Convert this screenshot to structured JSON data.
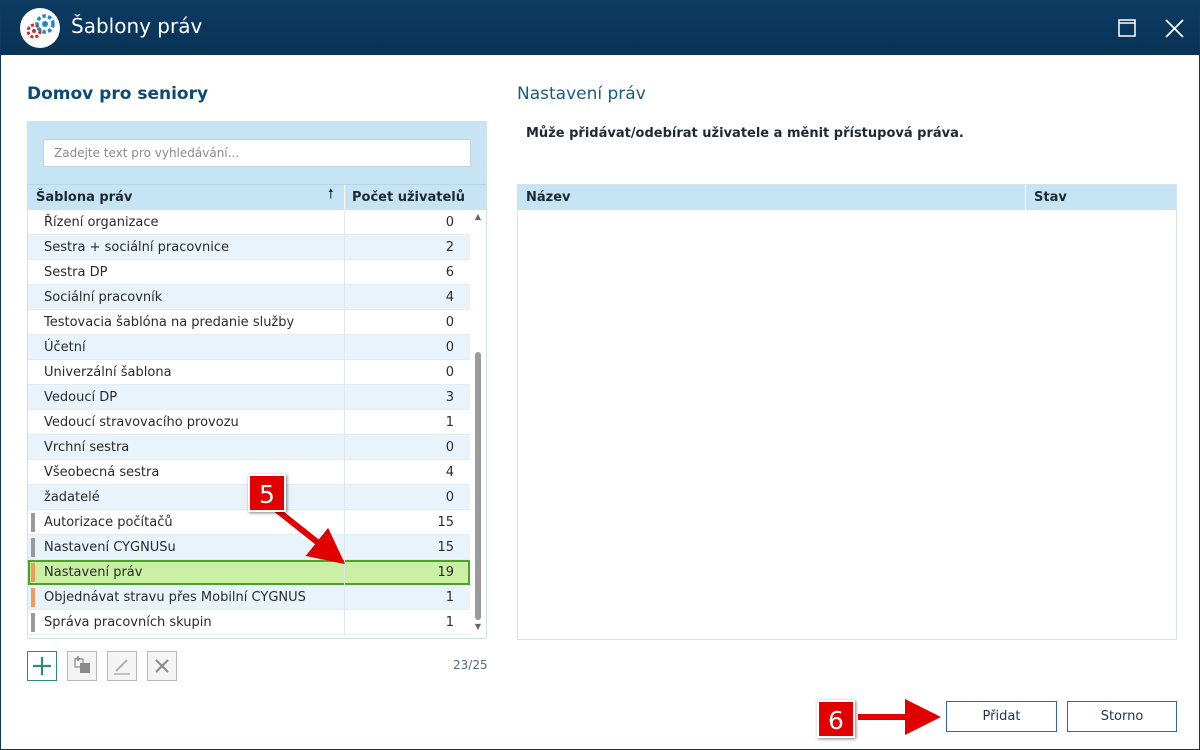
{
  "window": {
    "title": "Šablony práv"
  },
  "left": {
    "heading": "Domov pro seniory",
    "search_placeholder": "Zadejte text pro vyhledávání...",
    "columns": {
      "name": "Šablona práv",
      "count": "Počet uživatelů"
    },
    "rows": [
      {
        "name": "Řízení organizace",
        "count": "0",
        "marker": ""
      },
      {
        "name": "Sestra + sociální pracovnice",
        "count": "2",
        "marker": ""
      },
      {
        "name": "Sestra DP",
        "count": "6",
        "marker": ""
      },
      {
        "name": "Sociální pracovník",
        "count": "4",
        "marker": ""
      },
      {
        "name": "Testovacia šablóna na predanie služby",
        "count": "0",
        "marker": ""
      },
      {
        "name": "Účetní",
        "count": "0",
        "marker": ""
      },
      {
        "name": "Univerzální šablona",
        "count": "0",
        "marker": ""
      },
      {
        "name": "Vedoucí DP",
        "count": "3",
        "marker": ""
      },
      {
        "name": "Vedoucí stravovacího provozu",
        "count": "1",
        "marker": ""
      },
      {
        "name": "Vrchní sestra",
        "count": "0",
        "marker": ""
      },
      {
        "name": "Všeobecná sestra",
        "count": "4",
        "marker": ""
      },
      {
        "name": "žadatelé",
        "count": "0",
        "marker": ""
      },
      {
        "name": "Autorizace počítačů",
        "count": "15",
        "marker": "#9a9a9a"
      },
      {
        "name": "Nastavení CYGNUSu",
        "count": "15",
        "marker": "#9a9a9a"
      },
      {
        "name": "Nastavení práv",
        "count": "19",
        "marker": "#f29a58",
        "selected": true
      },
      {
        "name": "Objednávat stravu přes Mobilní CYGNUS",
        "count": "1",
        "marker": "#f29a58"
      },
      {
        "name": "Správa pracovních skupin",
        "count": "1",
        "marker": "#9a9a9a"
      }
    ],
    "counter": "23/25"
  },
  "right": {
    "heading": "Nastavení práv",
    "description": "Může přidávat/odebírat uživatele a měnit přístupová práva.",
    "columns": {
      "name": "Název",
      "state": "Stav"
    }
  },
  "buttons": {
    "add": "Přidat",
    "cancel": "Storno"
  },
  "annotations": {
    "step5": "5",
    "step6": "6"
  },
  "colors": {
    "titlebar": "#0b3a62",
    "header": "#c7e4f5",
    "selected": "#c9f0a4",
    "accent": "#e00000"
  }
}
